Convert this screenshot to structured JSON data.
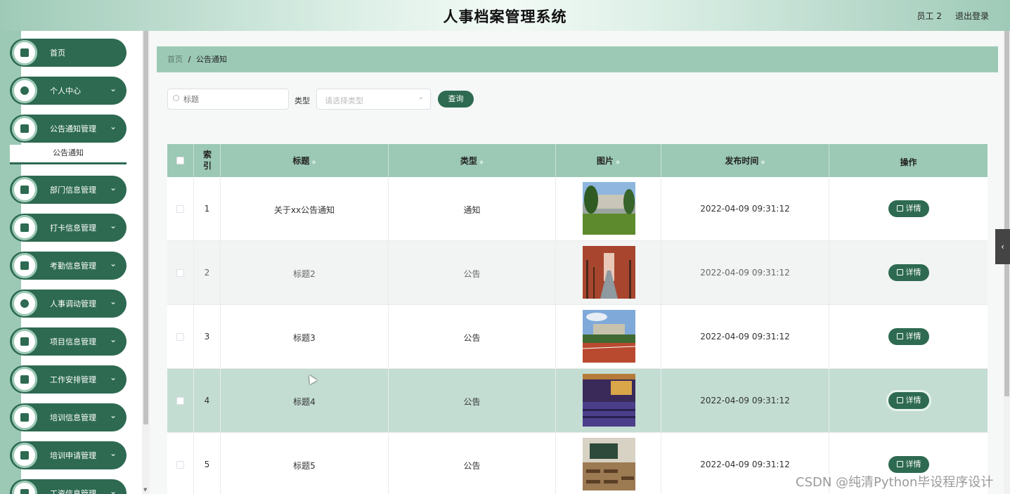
{
  "header": {
    "title": "人事档案管理系统",
    "user": "员工 2",
    "logout": "退出登录"
  },
  "sidebar": {
    "items": [
      {
        "label": "首页",
        "icon": "home-icon"
      },
      {
        "label": "个人中心",
        "icon": "user-icon"
      },
      {
        "label": "公告通知管理",
        "icon": "message-icon"
      },
      {
        "label": "部门信息管理",
        "icon": "monitor-icon"
      },
      {
        "label": "打卡信息管理",
        "icon": "grid-icon"
      },
      {
        "label": "考勤信息管理",
        "icon": "chart-icon"
      },
      {
        "label": "人事调动管理",
        "icon": "user-icon"
      },
      {
        "label": "项目信息管理",
        "icon": "grid-icon"
      },
      {
        "label": "工作安排管理",
        "icon": "bar-chart-icon"
      },
      {
        "label": "培训信息管理",
        "icon": "sliders-icon"
      },
      {
        "label": "培训申请管理",
        "icon": "list-icon"
      },
      {
        "label": "工资信息管理",
        "icon": "grid-icon"
      }
    ],
    "submenu": "公告通知"
  },
  "breadcrumb": {
    "home": "首页",
    "current": "公告通知"
  },
  "search": {
    "title_placeholder": "标题",
    "type_label": "类型",
    "type_placeholder": "请选择类型",
    "query_button": "查询"
  },
  "table": {
    "headers": {
      "index": "索引",
      "title": "标题",
      "type": "类型",
      "image": "图片",
      "time": "发布时间",
      "action": "操作"
    },
    "detail_label": "详情",
    "rows": [
      {
        "index": "1",
        "title": "关于xx公告通知",
        "type": "通知",
        "time": "2022-04-09 09:31:12"
      },
      {
        "index": "2",
        "title": "标题2",
        "type": "公告",
        "time": "2022-04-09 09:31:12"
      },
      {
        "index": "3",
        "title": "标题3",
        "type": "公告",
        "time": "2022-04-09 09:31:12"
      },
      {
        "index": "4",
        "title": "标题4",
        "type": "公告",
        "time": "2022-04-09 09:31:12"
      },
      {
        "index": "5",
        "title": "标题5",
        "type": "公告",
        "time": "2022-04-09 09:31:12"
      }
    ]
  },
  "watermark": "CSDN @纯清Python毕设程序设计",
  "colors": {
    "primary": "#2d6a51",
    "accent": "#9cc9b6"
  }
}
